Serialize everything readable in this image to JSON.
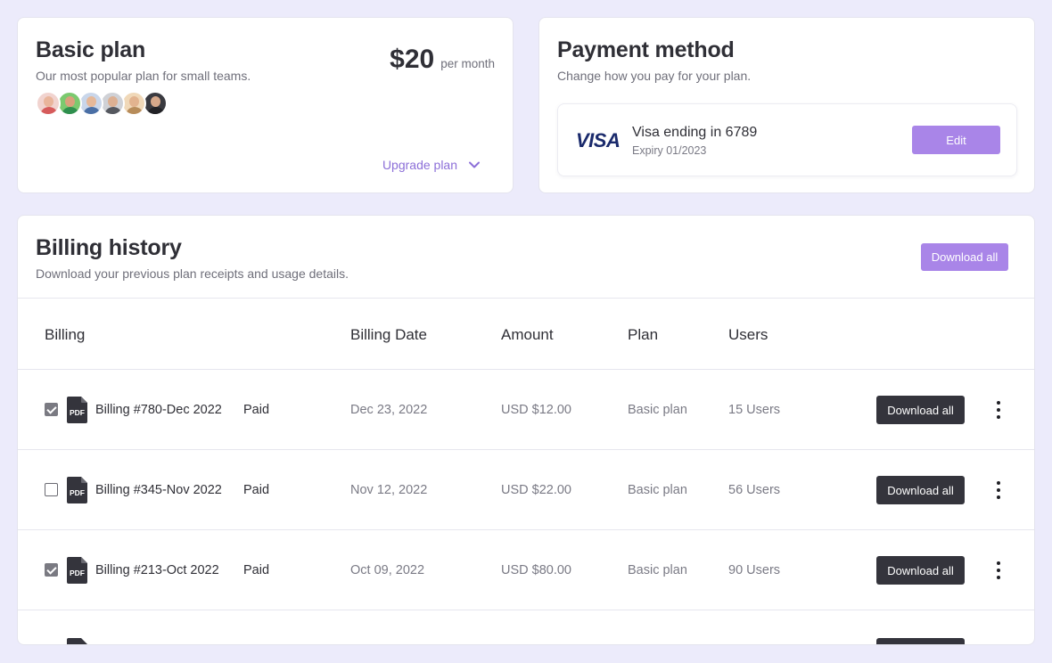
{
  "plan": {
    "title": "Basic plan",
    "subtitle": "Our most popular plan for small teams.",
    "price": "$20",
    "period": "per month",
    "upgrade_label": "Upgrade plan",
    "avatars": [
      {
        "skin": "#e9b59b",
        "shirt": "#d65b5b",
        "ring": "#f1d3cf"
      },
      {
        "skin": "#d9a07c",
        "shirt": "#2f8f4e",
        "ring": "#7bc96f"
      },
      {
        "skin": "#e5b899",
        "shirt": "#4a6fa5",
        "ring": "#c9d6ea"
      },
      {
        "skin": "#dcb093",
        "shirt": "#55585f",
        "ring": "#cfd1d6"
      },
      {
        "skin": "#e2b38f",
        "shirt": "#b78c5a",
        "ring": "#f0d8b8"
      },
      {
        "skin": "#d6a88a",
        "shirt": "#222226",
        "ring": "#3a3a40"
      }
    ]
  },
  "payment": {
    "title": "Payment method",
    "subtitle": "Change how you pay for your plan.",
    "card_brand": "VISA",
    "card_name": "Visa ending in 6789",
    "card_expiry": "Expiry 01/2023",
    "edit_label": "Edit"
  },
  "history": {
    "title": "Billing history",
    "subtitle": "Download your previous plan receipts and usage details.",
    "download_all_label": "Download all",
    "columns": [
      "Billing",
      "Billing Date",
      "Amount",
      "Plan",
      "Users"
    ],
    "rows": [
      {
        "checked": true,
        "invoice": "Billing #780-Dec 2022",
        "status": "Paid",
        "date": "Dec 23, 2022",
        "amount": "USD $12.00",
        "plan": "Basic plan",
        "users": "15 Users",
        "action": "Download all"
      },
      {
        "checked": false,
        "invoice": "Billing #345-Nov 2022",
        "status": "Paid",
        "date": "Nov 12, 2022",
        "amount": "USD $22.00",
        "plan": "Basic plan",
        "users": "56 Users",
        "action": "Download all"
      },
      {
        "checked": true,
        "invoice": "Billing #213-Oct 2022",
        "status": "Paid",
        "date": "Oct 09, 2022",
        "amount": "USD $80.00",
        "plan": "Basic plan",
        "users": "90 Users",
        "action": "Download all"
      }
    ]
  },
  "colors": {
    "background": "#ecebfb",
    "accent": "#a985e8",
    "accent_text": "#8c6fd8",
    "dark_button": "#34343c",
    "visa_blue": "#1a2a6c"
  },
  "icons": {
    "pdf": "pdf-file-icon",
    "chevron": "chevron-down-icon",
    "more": "kebab-menu-icon"
  }
}
